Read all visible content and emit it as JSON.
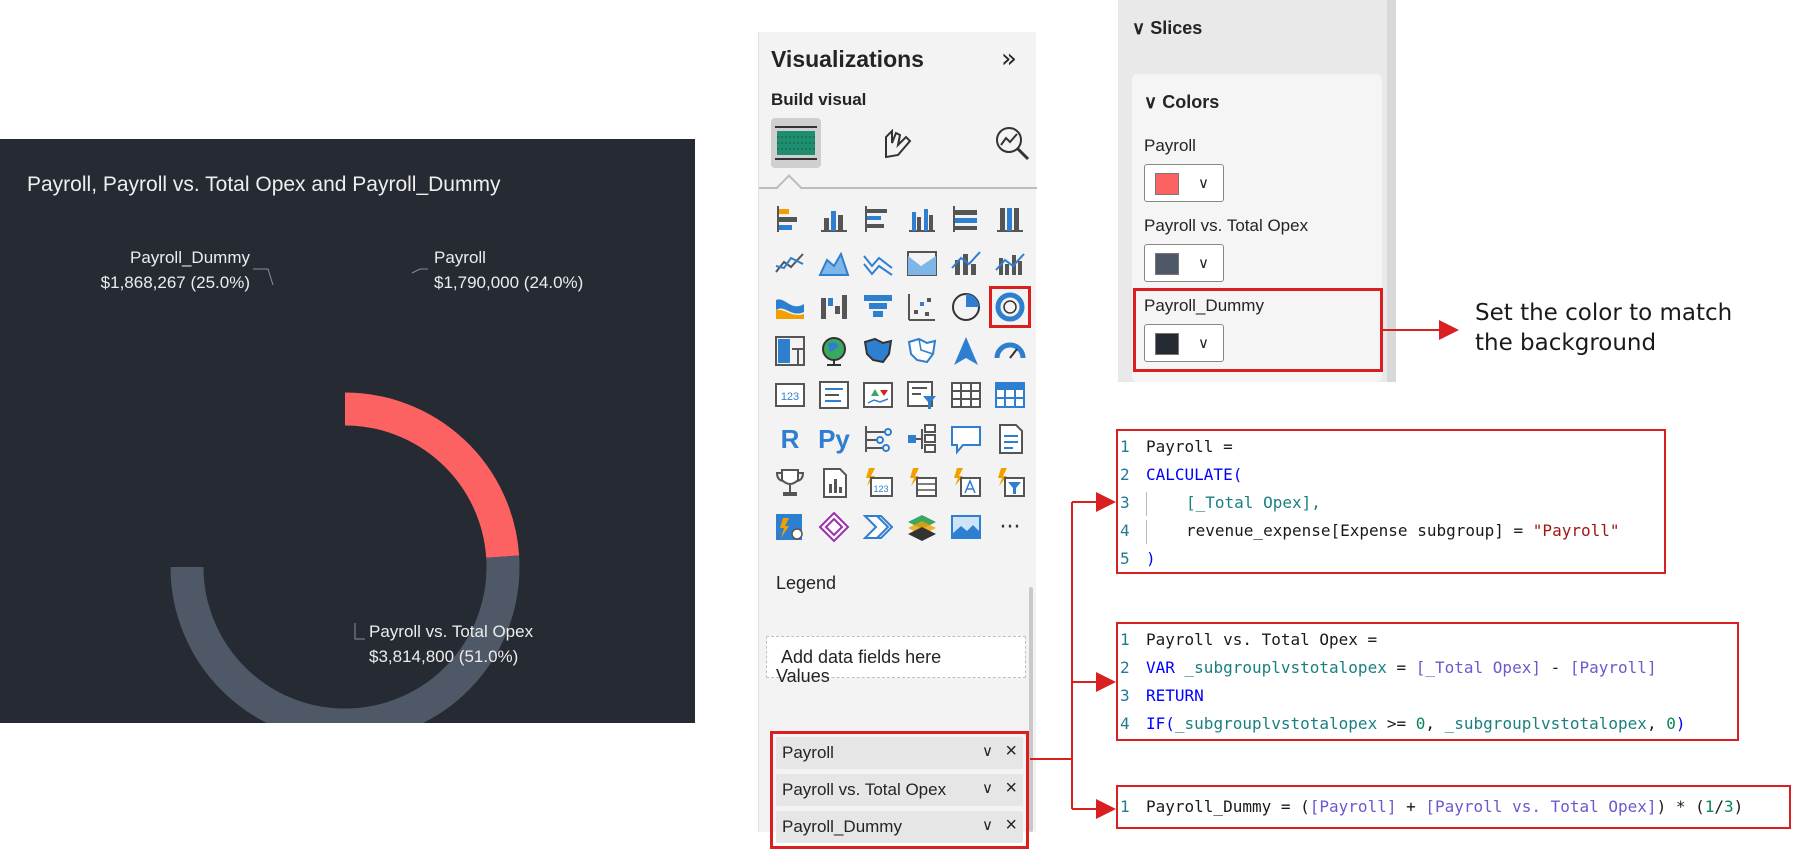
{
  "chart": {
    "title": "Payroll, Payroll vs. Total Opex and Payroll_Dummy",
    "labels": {
      "dummy_name": "Payroll_Dummy",
      "dummy_value": "$1,868,267 (25.0%)",
      "payroll_name": "Payroll",
      "payroll_value": "$1,790,000 (24.0%)",
      "opex_name": "Payroll vs. Total Opex",
      "opex_value": "$3,814,800 (51.0%)"
    }
  },
  "chart_data": {
    "type": "pie",
    "title": "Payroll, Payroll vs. Total Opex and Payroll_Dummy",
    "categories": [
      "Payroll",
      "Payroll vs. Total Opex",
      "Payroll_Dummy"
    ],
    "values": [
      1790000,
      3814800,
      1868267
    ],
    "percentages": [
      24.0,
      51.0,
      25.0
    ],
    "colors": [
      "#fd6262",
      "#4f5866",
      "#252a33"
    ],
    "style": "donut"
  },
  "viz_pane": {
    "title": "Visualizations",
    "collapse_glyph": "»",
    "build_visual": "Build visual",
    "legend_label": "Legend",
    "legend_placeholder": "Add data fields here",
    "values_label": "Values",
    "value_fields": [
      "Payroll",
      "Payroll vs. Total Opex",
      "Payroll_Dummy"
    ],
    "more_glyph": "···",
    "letters": {
      "r": "R",
      "py": "Py"
    }
  },
  "format_pane": {
    "slices_label": "Slices",
    "colors_label": "Colors",
    "colors": [
      {
        "label": "Payroll",
        "swatch": "#fd6262"
      },
      {
        "label": "Payroll vs. Total Opex",
        "swatch": "#4f5866"
      },
      {
        "label": "Payroll_Dummy",
        "swatch": "#252a33"
      }
    ],
    "chevron": "∨"
  },
  "annotation": {
    "line1": "Set the color to match",
    "line2": "the background"
  },
  "code": {
    "payroll": {
      "l1": "Payroll =",
      "l2": "CALCULATE(",
      "l3": "[_Total Opex],",
      "l4a": "revenue_expense[Expense subgroup]",
      "l4b": " = ",
      "l4c": "\"Payroll\"",
      "l5": ")"
    },
    "payroll_vs": {
      "l1": "Payroll vs. Total Opex =",
      "l2a": "VAR",
      "l2b": " _subgrouplvstotalopex",
      "l2c": " = ",
      "l2d": "[_Total Opex]",
      "l2e": " - ",
      "l2f": "[Payroll]",
      "l3": "RETURN",
      "l4a": "IF(",
      "l4b": "_subgrouplvstotalopex",
      "l4c": " >= ",
      "l4d": "0",
      "l4e": ", ",
      "l4f": "_subgrouplvstotalopex",
      "l4g": ", ",
      "l4h": "0",
      "l4i": ")"
    },
    "dummy": {
      "a": "Payroll_Dummy = (",
      "b": "[Payroll]",
      "c": " + ",
      "d": "[Payroll vs. Total Opex]",
      "e": ") * (",
      "f": "1",
      "g": "/",
      "h": "3",
      "i": ")"
    },
    "line_numbers": [
      "1",
      "2",
      "3",
      "4",
      "5"
    ]
  }
}
